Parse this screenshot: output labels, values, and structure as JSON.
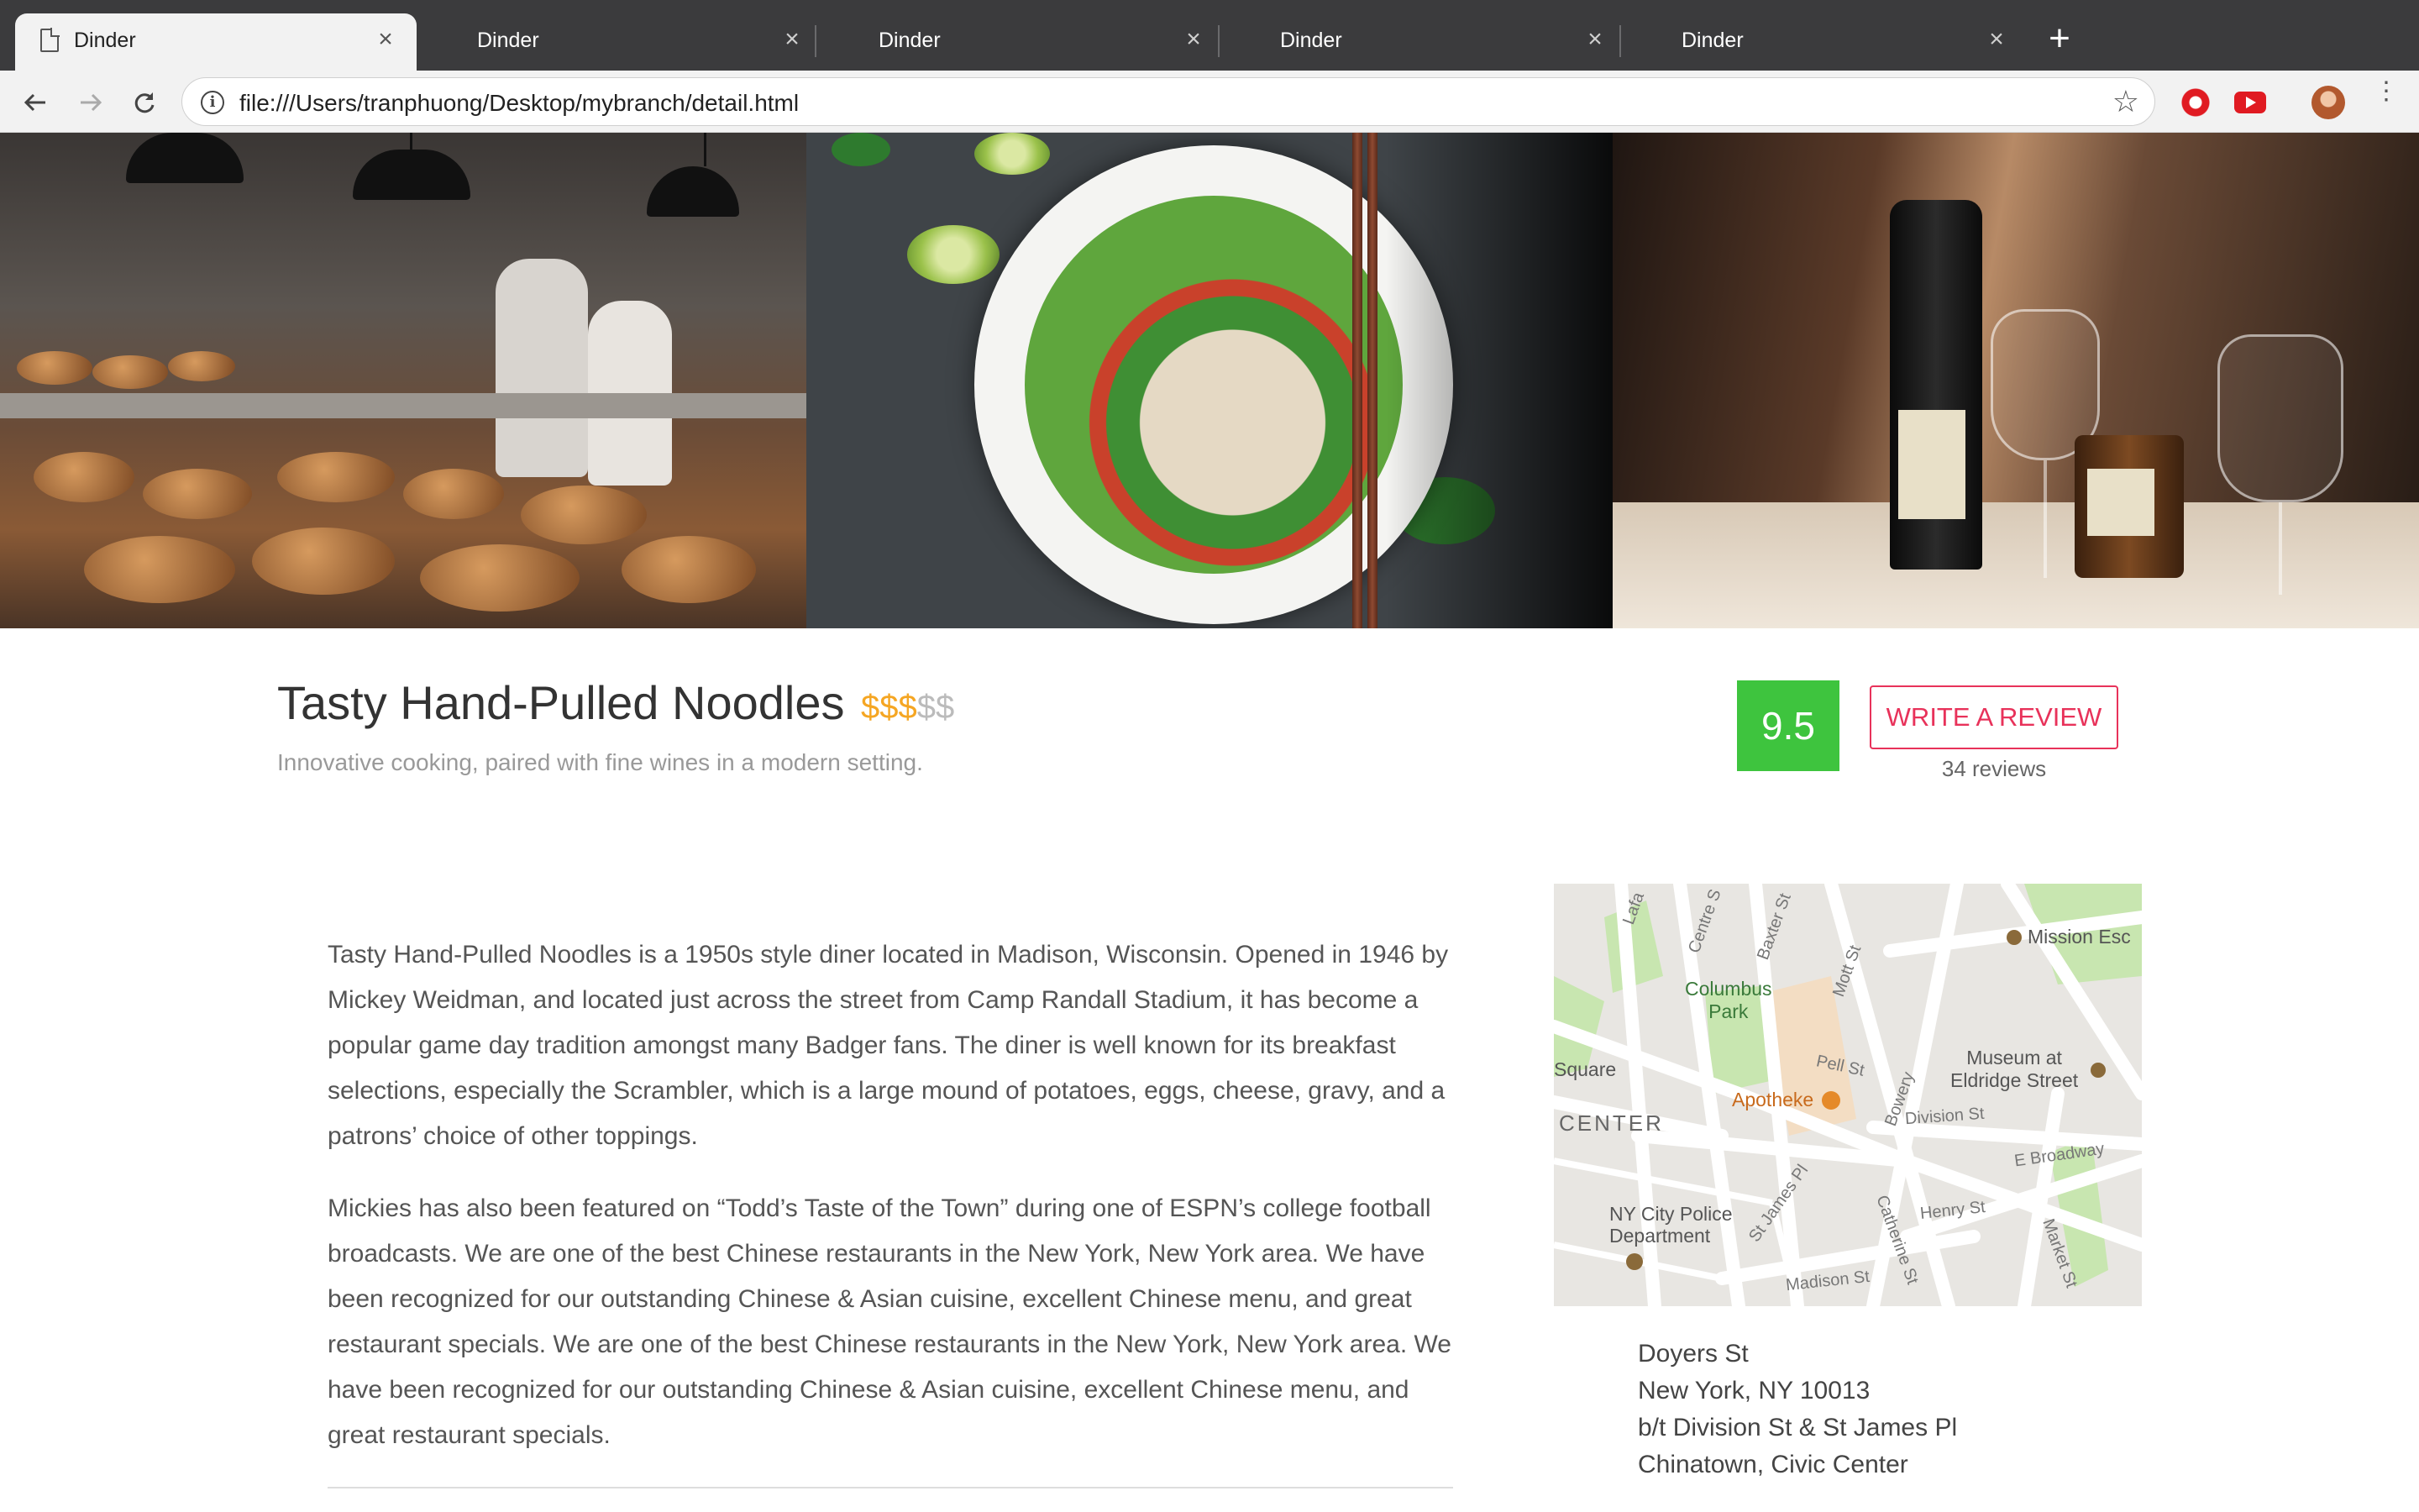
{
  "browser": {
    "tabs": [
      {
        "title": "Dinder",
        "active": true
      },
      {
        "title": "Dinder",
        "active": false
      },
      {
        "title": "Dinder",
        "active": false
      },
      {
        "title": "Dinder",
        "active": false
      },
      {
        "title": "Dinder",
        "active": false
      }
    ],
    "close_glyph": "×",
    "new_tab_glyph": "+",
    "url": "file:///Users/tranphuong/Desktop/mybranch/detail.html",
    "info_glyph": "i",
    "star_glyph": "☆",
    "menu_glyph": "⋮",
    "extensions": [
      "opera-icon",
      "youtube-icon"
    ]
  },
  "hero": {
    "images": [
      "bakery-photo",
      "noodle-bowl-photo",
      "wine-table-photo"
    ],
    "carousel_dots": 2,
    "active_dot": 0
  },
  "restaurant": {
    "name": "Tasty Hand-Pulled Noodles",
    "price_active": "$$$",
    "price_inactive": "$$",
    "tagline": "Innovative cooking, paired with fine wines in a modern setting.",
    "score": "9.5",
    "score_color": "#3ec43e",
    "review_button": "WRITE A REVIEW",
    "review_count": "34 reviews",
    "accent_color": "#e8325a"
  },
  "description": [
    "Tasty Hand-Pulled Noodles is a 1950s style diner located in Madison, Wisconsin. Opened in 1946 by Mickey Weidman, and located just across the street from Camp Randall Stadium, it has become a popular game day tradition amongst many Badger fans. The diner is well known for its breakfast selections, especially the Scrambler, which is a large mound of potatoes, eggs, cheese, gravy, and a patrons’ choice of other toppings.",
    "Mickies has also been featured on “Todd’s Taste of the Town” during one of ESPN’s college football broadcasts. We are one of the best Chinese restaurants in the New York, New York area. We have been recognized for our outstanding Chinese & Asian cuisine, excellent Chinese menu, and great restaurant specials. We are one of the best Chinese restaurants in the New York, New York area. We have been recognized for our outstanding Chinese & Asian cuisine, excellent Chinese menu, and great restaurant specials."
  ],
  "map": {
    "labels": {
      "lafayette": "Lafa",
      "centre": "Centre S",
      "baxter": "Baxter St",
      "mott": "Mott St",
      "mission": "Mission Esc",
      "columbus_park": "Columbus\nPark",
      "square": "Square",
      "pell": "Pell St",
      "bowery": "Bowery",
      "museum": "Museum at\nEldridge Street",
      "apotheke": "Apotheke",
      "center": "CENTER",
      "division": "Division St",
      "broadway": "E Broadway",
      "police": "NY City Police\nDepartment",
      "henry": "Henry St",
      "catherine": "Catherine St",
      "market": "Market St",
      "st_james": "St James Pl",
      "madison": "Madison St"
    }
  },
  "address": [
    "Doyers St",
    "New York, NY 10013",
    "b/t Division St & St James Pl",
    "Chinatown, Civic Center"
  ]
}
